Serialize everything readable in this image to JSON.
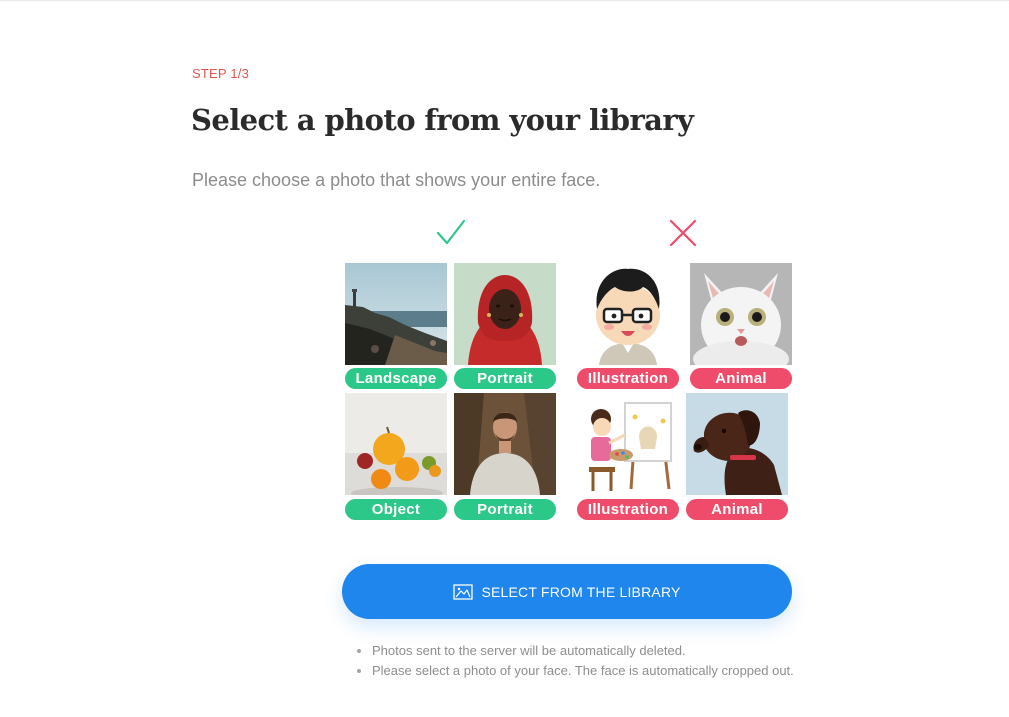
{
  "step_label": "STEP 1/3",
  "title": "Select a photo from your library",
  "subtitle": "Please choose a photo that shows your entire face.",
  "good_examples": {
    "icon": "check-icon",
    "color": "#2cc889",
    "items": [
      {
        "label": "Landscape",
        "image": "landscape-photo"
      },
      {
        "label": "Portrait",
        "image": "portrait-photo-woman"
      },
      {
        "label": "Object",
        "image": "fruit-photo"
      },
      {
        "label": "Portrait",
        "image": "portrait-photo-man"
      }
    ]
  },
  "bad_examples": {
    "icon": "cross-icon",
    "color": "#ef4b6a",
    "items": [
      {
        "label": "Illustration",
        "image": "illustration-man"
      },
      {
        "label": "Animal",
        "image": "cat-photo"
      },
      {
        "label": "Illustration",
        "image": "illustration-painter"
      },
      {
        "label": "Animal",
        "image": "dog-photo"
      }
    ]
  },
  "cta": {
    "label": "SELECT FROM THE LIBRARY",
    "icon": "image-icon",
    "color": "#1e86ec"
  },
  "notes": [
    "Photos sent to the server will be automatically deleted.",
    "Please select a photo of your face. The face is automatically cropped out."
  ]
}
